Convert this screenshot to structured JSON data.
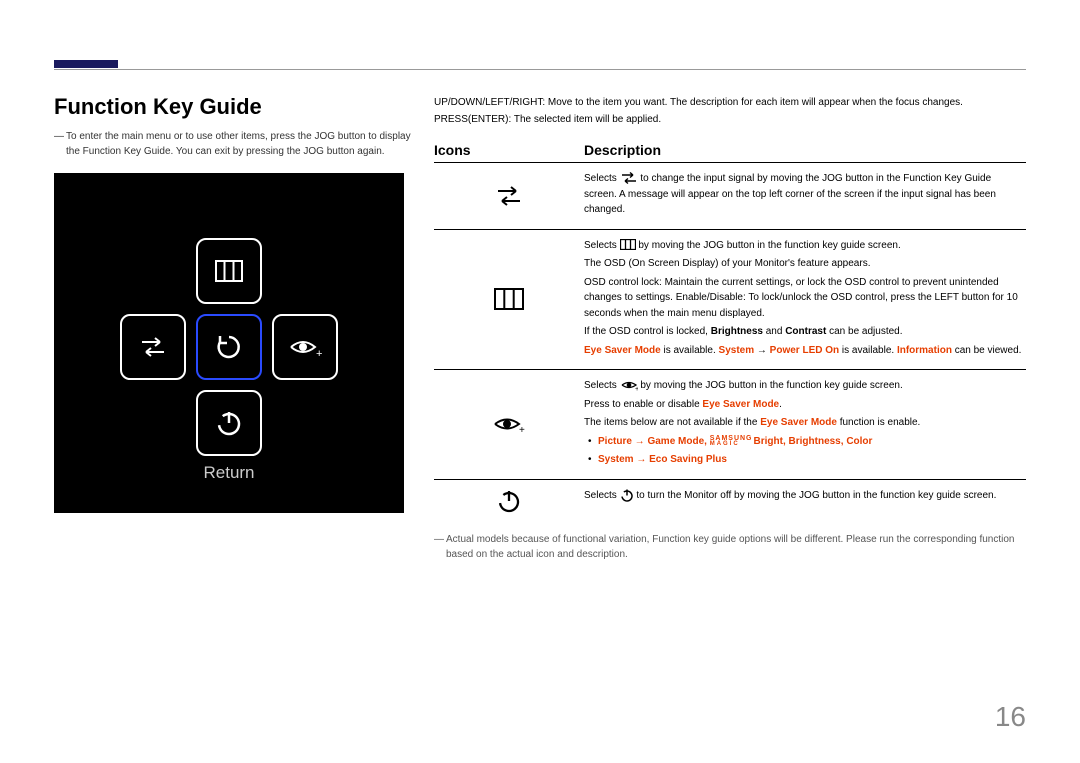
{
  "page": {
    "title": "Function Key Guide",
    "note": "To enter the main menu or to use other items, press the JOG button to display the Function Key Guide. You can exit by pressing the JOG button again.",
    "page_number": "16"
  },
  "osd": {
    "caption": "Return"
  },
  "table": {
    "header_icons": "Icons",
    "header_desc": "Description",
    "intro_line1": "UP/DOWN/LEFT/RIGHT: Move to the item you want. The description for each item will appear when the focus changes.",
    "intro_line2": "PRESS(ENTER): The selected item will be applied.",
    "footnote": "Actual models because of functional variation, Function key guide options will be different. Please run the corresponding function based on the actual icon and description."
  },
  "rows": {
    "r1": {
      "t1a": "Selects ",
      "t1b": " to change the input signal by moving the JOG button in the Function Key Guide screen. A message will appear on the top left corner of the screen if the input signal has been changed."
    },
    "r2": {
      "p1a": "Selects ",
      "p1b": " by moving the JOG button in the function key guide screen.",
      "p2": "The OSD (On Screen Display) of your Monitor's feature appears.",
      "p3": "OSD control lock: Maintain the current settings, or lock the OSD control to prevent unintended changes to settings. Enable/Disable: To lock/unlock the OSD control, press the LEFT button for 10 seconds when the main menu displayed.",
      "p4a": "If the OSD control is locked, ",
      "p4_brightness": "Brightness",
      "p4_and": " and ",
      "p4_contrast": "Contrast",
      "p4b": " can be adjusted.",
      "p5_eye": "Eye Saver Mode",
      "p5a": " is available. ",
      "p5_system": "System",
      "p5_arrow": " → ",
      "p5_power": "Power LED On",
      "p5b": " is available. ",
      "p5_info": "Information",
      "p5c": " can be viewed."
    },
    "r3": {
      "p1a": "Selects ",
      "p1b": " by moving the JOG button in the function key guide screen.",
      "p2a": "Press to enable or disable ",
      "p2_eye": "Eye Saver Mode",
      "p2b": ".",
      "p3a": "The items below are not available if the ",
      "p3_eye": "Eye Saver Mode",
      "p3b": " function is enable.",
      "b1_picture": "Picture",
      "b1_arrow": " → ",
      "b1_game": "Game Mode",
      "b1_comma": ", ",
      "b1_bright": "Bright",
      "b1_brightness": "Brightness",
      "b1_color": "Color",
      "b2_system": "System",
      "b2_arrow": " → ",
      "b2_eco": "Eco Saving Plus"
    },
    "r4": {
      "t1a": "Selects ",
      "t1b": " to turn the Monitor off by moving the JOG button in the function key guide screen."
    }
  }
}
